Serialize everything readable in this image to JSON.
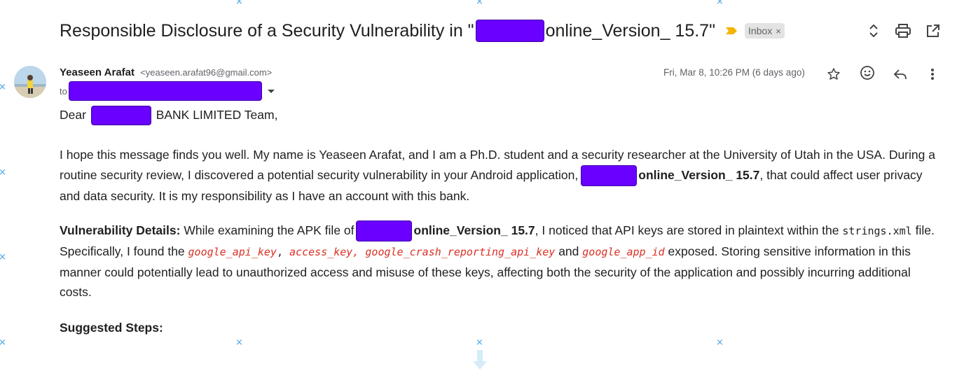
{
  "subject": {
    "prefix": "Responsible Disclosure of a Security Vulnerability in \"",
    "suffix": "online_Version_ 15.7\"",
    "label": "Inbox",
    "label_close": "×"
  },
  "sender": {
    "name": "Yeaseen Arafat",
    "email": "<yeaseen.arafat96@gmail.com>",
    "to_label": "to"
  },
  "date": "Fri, Mar 8, 10:26 PM (6 days ago)",
  "body": {
    "greeting_pre": "Dear",
    "greeting_post": "BANK LIMITED Team,",
    "p1_a": "I hope this message finds you well. My name is Yeaseen Arafat, and I am a Ph.D. student and a security researcher at the University of Utah in the USA. During a routine security review, I discovered a potential security vulnerability in your Android application,",
    "p1_app": "online_Version_ 15.7",
    "p1_b": ", that could affect user privacy and data security. It is my responsibility as I have an account with this bank.",
    "p2_label": "Vulnerability Details:",
    "p2_a": " While examining the APK file of",
    "p2_app": "online_Version_ 15.7",
    "p2_b": ", I noticed that API keys are stored in plaintext within the ",
    "p2_file": "strings.xml",
    "p2_c": " file. Specifically, I found the ",
    "key1": "google_api_key",
    "comma1": ", ",
    "key2": "access_key, google_crash_reporting_api_key",
    "and": " and ",
    "key3": "google_app_id",
    "p2_d": " exposed. Storing sensitive information in this manner could potentially lead to unauthorized access and misuse of these keys, affecting both the security of the application and possibly incurring additional costs.",
    "steps": "Suggested Steps:"
  },
  "icons": {
    "importance": "importance-marker-icon",
    "nav": "expand-collapse-icon",
    "print": "print-icon",
    "popout": "open-in-new-window-icon",
    "star": "star-icon",
    "emoji": "add-reaction-icon",
    "reply": "reply-icon",
    "more": "more-vert-icon"
  },
  "colors": {
    "redaction": "#6a00ff",
    "key_text": "#d93025",
    "importance": "#f4b400"
  }
}
